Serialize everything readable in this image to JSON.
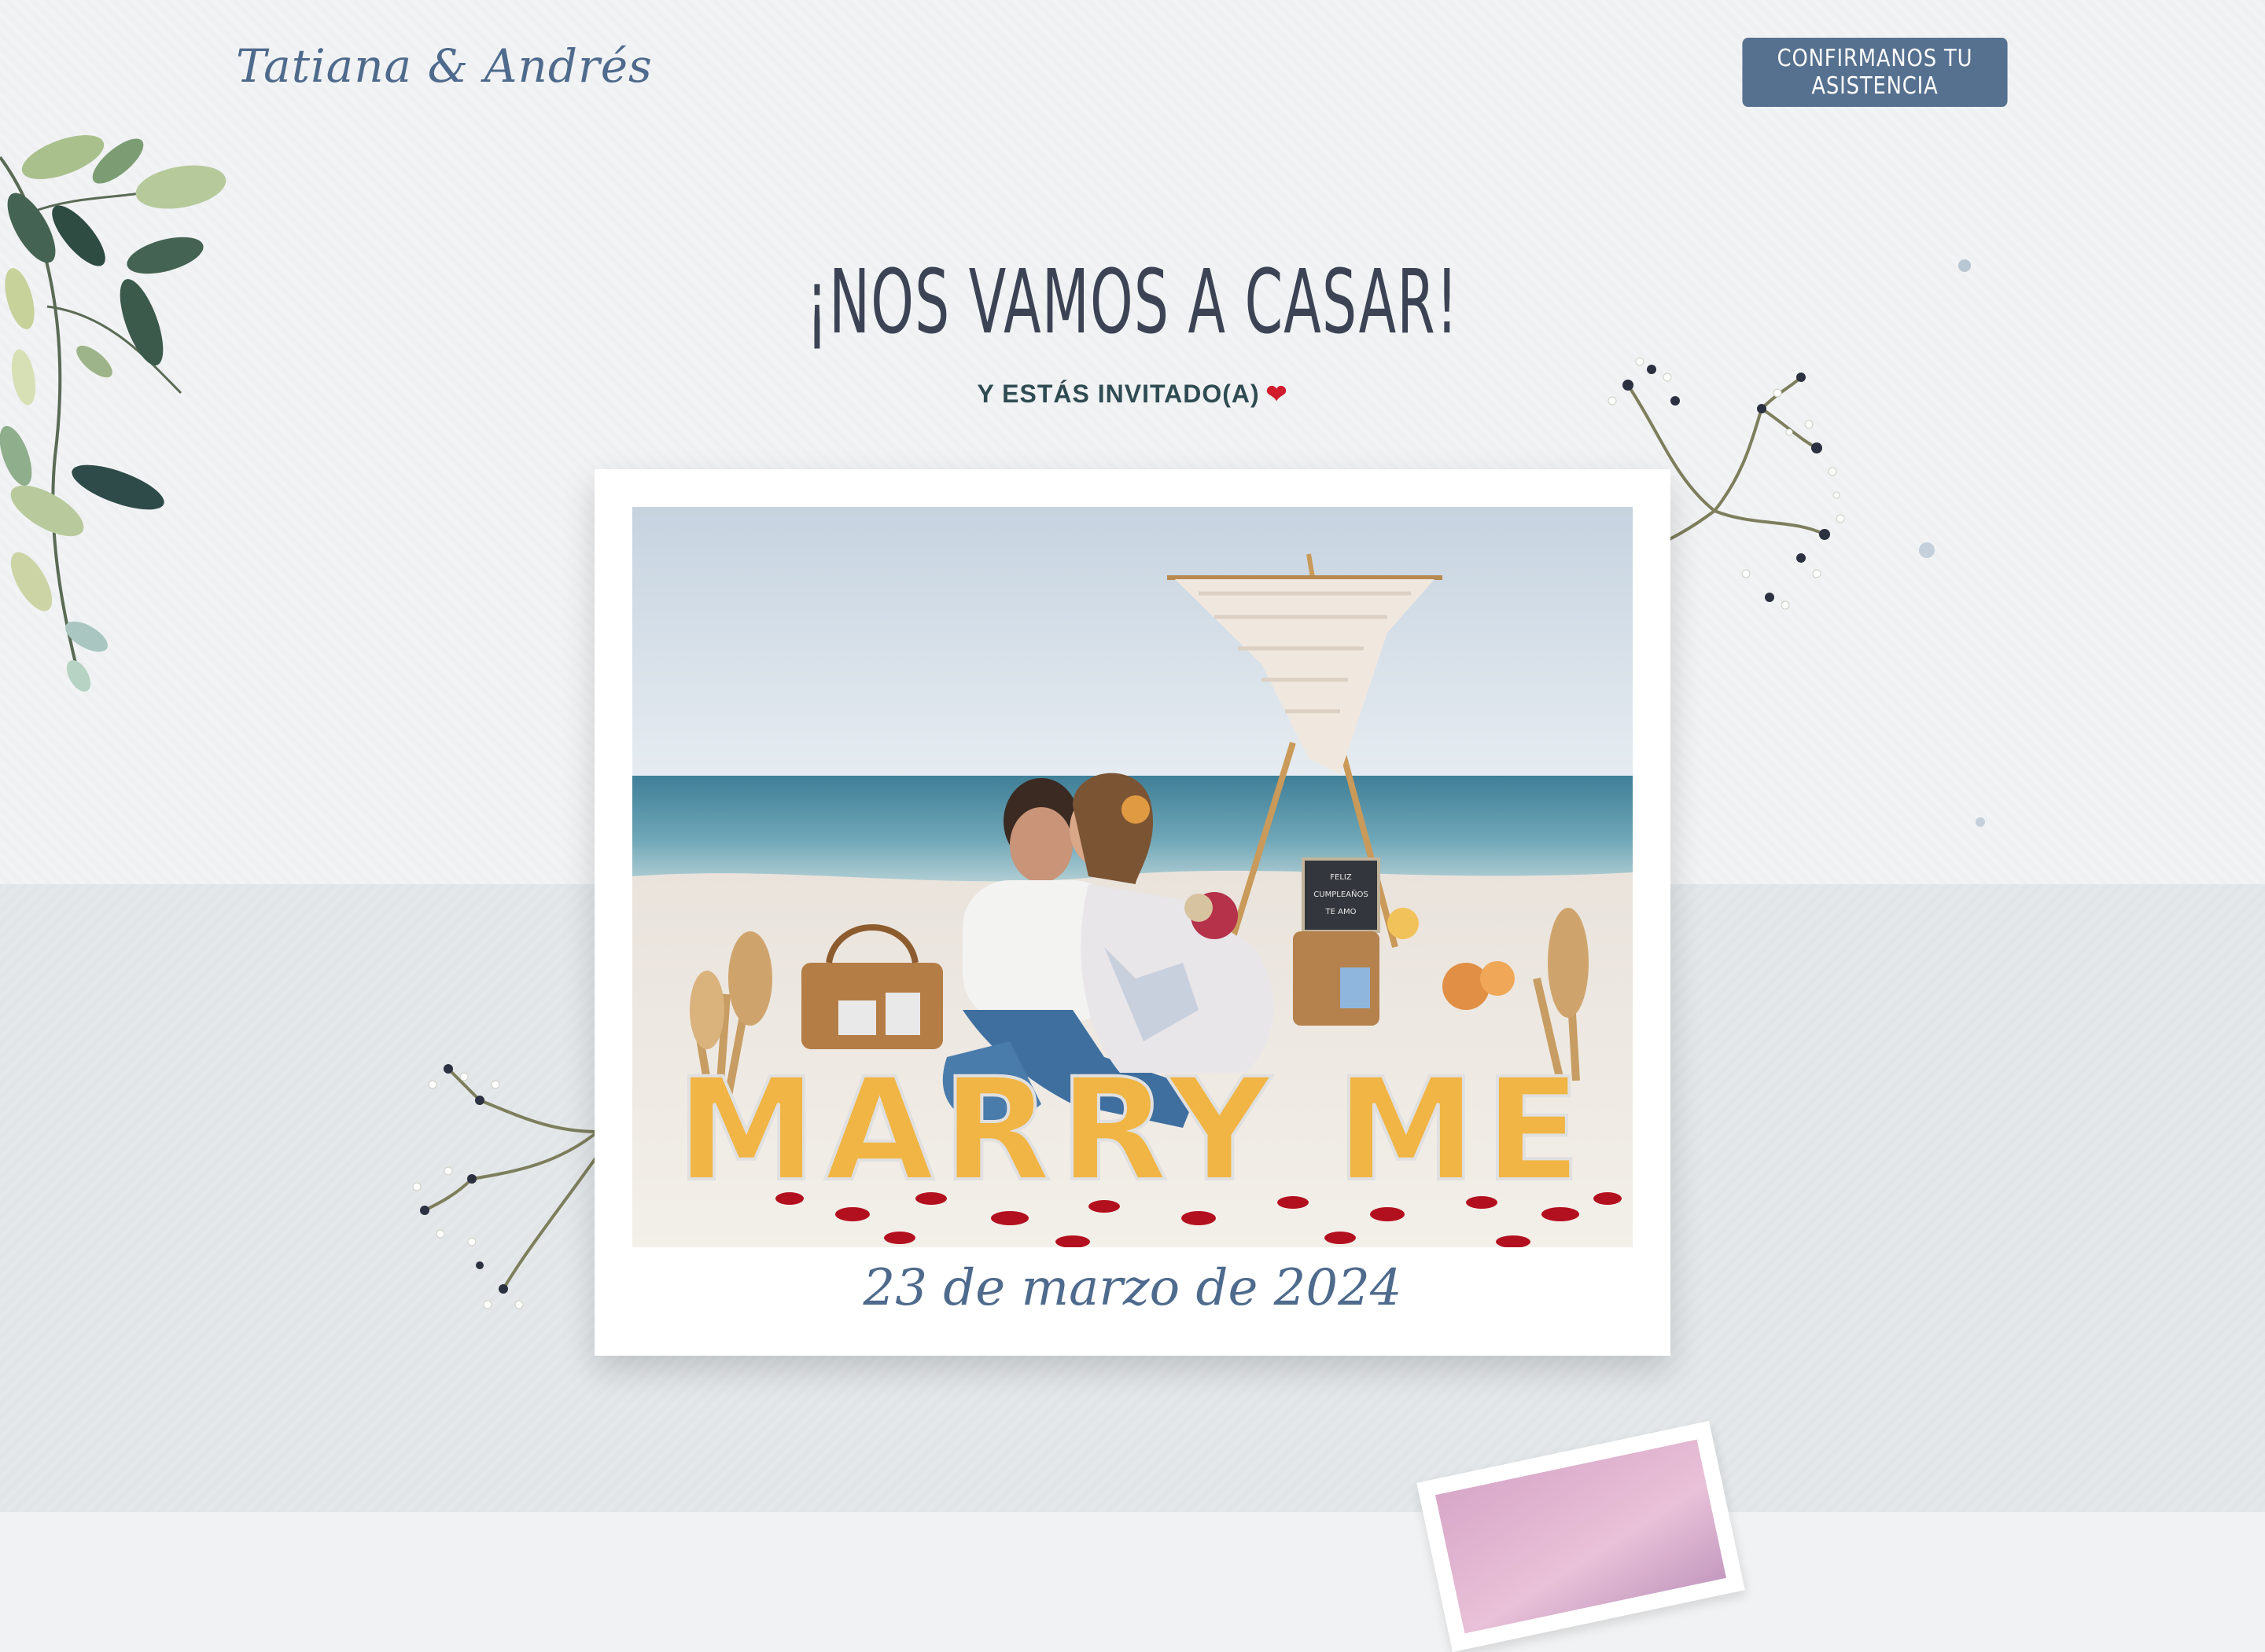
{
  "header": {
    "brand": "Tatiana & Andrés",
    "rsvp_button": "CONFIRMANOS TU ASISTENCIA"
  },
  "hero": {
    "title": "¡NOS VAMOS A CASAR!",
    "subtitle": "Y ESTÁS INVITADO(A)",
    "heart": "❤"
  },
  "photo_card": {
    "sign_text": "MARRY ME",
    "letterboard_lines": [
      "FELIZ",
      "CUMPLEAÑOS",
      "TE AMO"
    ],
    "date": "23 de marzo de 2024"
  },
  "colors": {
    "accent": "#56708f",
    "title": "#3b4354",
    "subtitle": "#2f4b52",
    "heart": "#d01c2c",
    "background_top": "#f1f2f3",
    "background_bottom": "#e2e6e8"
  },
  "icons": [
    "leaf-branch-icon",
    "gypsophila-flower-icon",
    "heart-icon"
  ]
}
